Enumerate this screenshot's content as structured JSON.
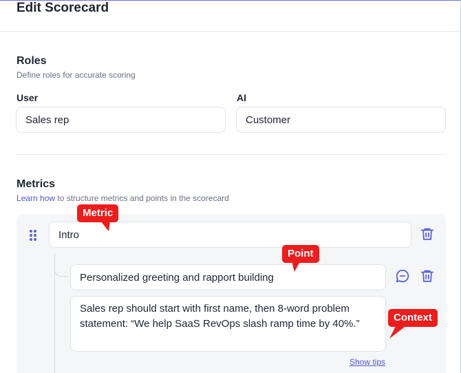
{
  "header": {
    "title": "Edit Scorecard"
  },
  "roles": {
    "title": "Roles",
    "subtitle": "Define roles for accurate scoring",
    "user": {
      "label": "User",
      "value": "Sales rep"
    },
    "ai": {
      "label": "AI",
      "value": "Customer"
    }
  },
  "metrics": {
    "title": "Metrics",
    "learn_link": "Learn how",
    "subtitle_rest": " to structure metrics and points in the scorecard",
    "metric": {
      "name": "Intro"
    },
    "point": {
      "text": "Personalized greeting and rapport building",
      "context": "Sales rep should start with first name, then 8-word problem statement: “We help SaaS RevOps slash ramp time by 40%.”"
    },
    "show_tips": "Show tips"
  },
  "annotations": {
    "metric": "Metric",
    "point": "Point",
    "context": "Context"
  },
  "icons": {
    "drag": "drag-handle-icon",
    "trash": "trash-icon",
    "comment": "comment-icon"
  },
  "colors": {
    "accent": "#5b60d8",
    "link": "#4f56d6",
    "callout": "#ee1c1c",
    "panel": "#f5f6f8"
  }
}
